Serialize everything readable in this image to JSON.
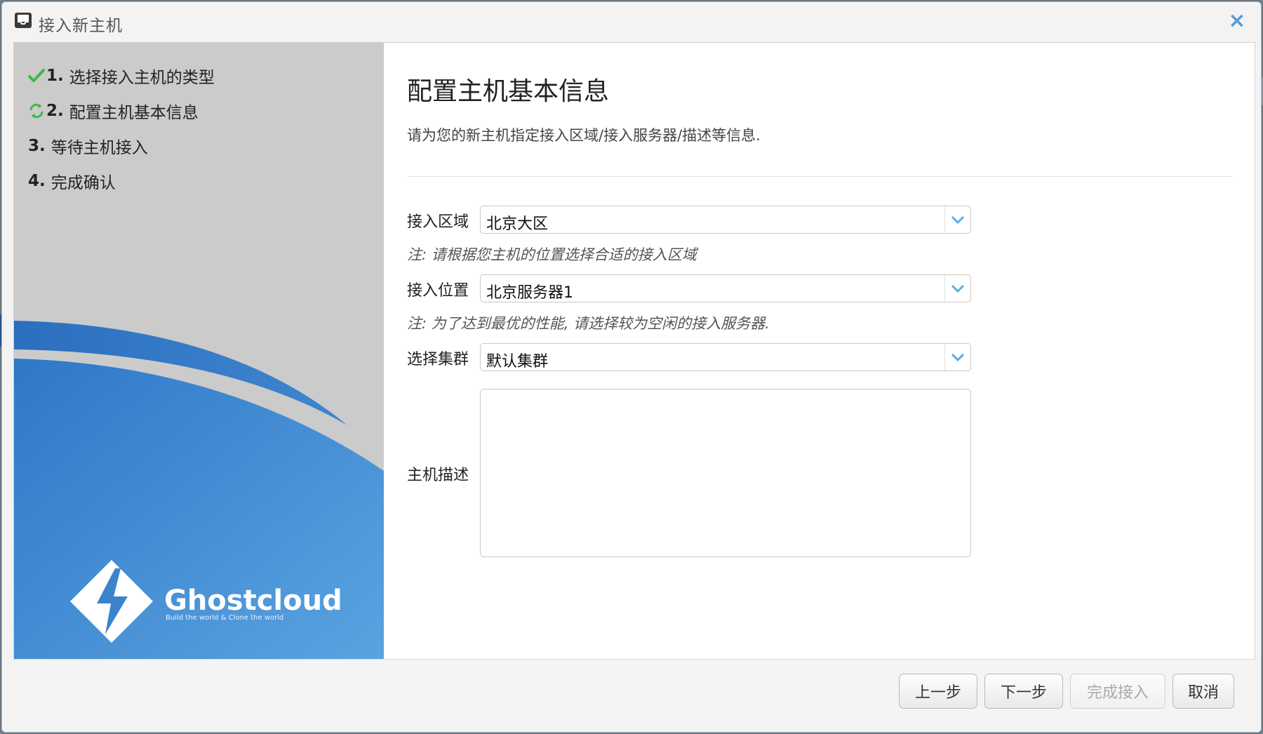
{
  "window": {
    "title": "接入新主机",
    "close_symbol": "×"
  },
  "sidebar": {
    "steps": [
      {
        "number": "1.",
        "label": "选择接入主机的类型",
        "status": "done",
        "icon": "check-icon"
      },
      {
        "number": "2.",
        "label": "配置主机基本信息",
        "status": "current",
        "icon": "refresh-icon"
      },
      {
        "number": "3.",
        "label": "等待主机接入",
        "status": "pending"
      },
      {
        "number": "4.",
        "label": "完成确认",
        "status": "pending"
      }
    ],
    "brand": {
      "name": "Ghostcloud",
      "tagline": "Build the world & Clone the world"
    }
  },
  "main": {
    "heading": "配置主机基本信息",
    "subheading": "请为您的新主机指定接入区域/接入服务器/描述等信息.",
    "fields": {
      "region": {
        "label": "接入区域",
        "value": "北京大区",
        "note": "注: 请根据您主机的位置选择合适的接入区域"
      },
      "location": {
        "label": "接入位置",
        "value": "北京服务器1",
        "note": "注: 为了达到最优的性能, 请选择较为空闲的接入服务器."
      },
      "cluster": {
        "label": "选择集群",
        "value": "默认集群"
      },
      "description": {
        "label": "主机描述",
        "value": ""
      }
    }
  },
  "footer": {
    "prev_label": "上一步",
    "next_label": "下一步",
    "finish_label": "完成接入",
    "cancel_label": "取消"
  },
  "colors": {
    "accent_blue": "#5a9bd5",
    "check_green": "#3cb84a",
    "sidebar_bg": "#cbcbcb"
  }
}
